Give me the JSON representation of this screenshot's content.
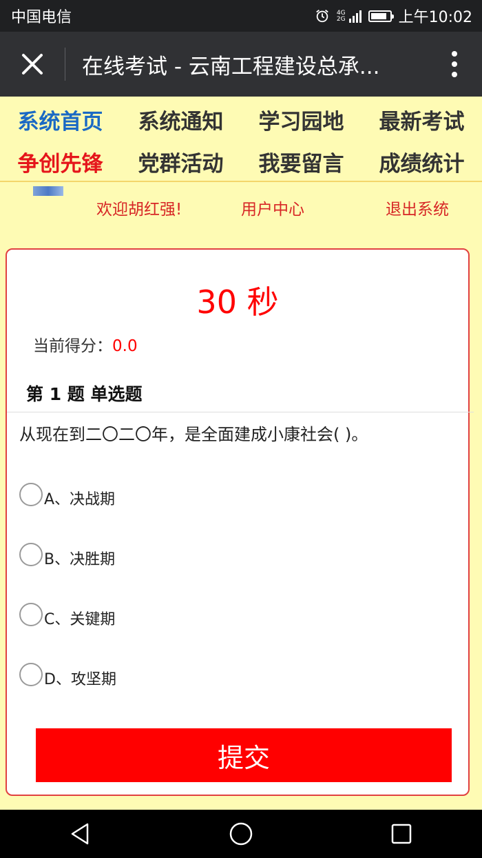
{
  "status_bar": {
    "carrier": "中国电信",
    "network": [
      "4G",
      "2G"
    ],
    "time": "上午10:02",
    "battery_level": 0.85
  },
  "title_bar": {
    "title": "在线考试 - 云南工程建设总承..."
  },
  "nav": {
    "row1": [
      "系统首页",
      "系统通知",
      "学习园地",
      "最新考试"
    ],
    "row2": [
      "争创先锋",
      "党群活动",
      "我要留言",
      "成绩统计"
    ]
  },
  "user_bar": {
    "welcome": "欢迎胡红强!",
    "user_center": "用户中心",
    "logout": "退出系统"
  },
  "exam": {
    "timer": "30 秒",
    "score_label": "当前得分：",
    "score_value": "0.0",
    "question_header": "第 1 题 单选题",
    "question_text": "从现在到二〇二〇年，是全面建成小康社会( )。",
    "options": [
      "A、决战期",
      "B、决胜期",
      "C、关键期",
      "D、攻坚期"
    ],
    "submit_label": "提交"
  },
  "colors": {
    "page_bg": "#fefbb4",
    "accent_red": "#ff0000",
    "nav_blue": "#1a69c4"
  },
  "icons": {
    "close": "close-icon",
    "more": "more-vertical-icon",
    "back": "back-triangle-icon",
    "home": "home-circle-icon",
    "recents": "recents-square-icon"
  }
}
